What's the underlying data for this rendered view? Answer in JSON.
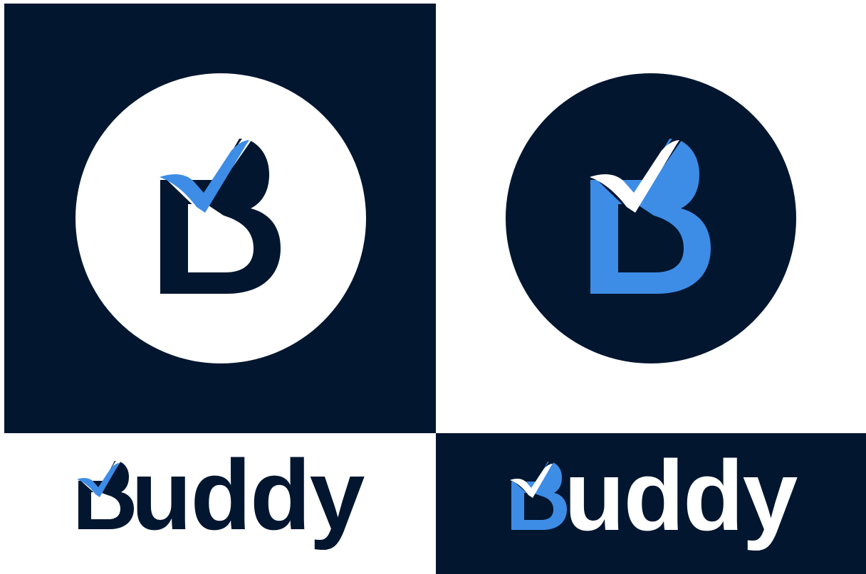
{
  "brand": {
    "wordmark_rest": "uddy",
    "wordmark_full": "Buddy",
    "letter": "B"
  },
  "colors": {
    "navy": "#02162f",
    "blue": "#3d8de6",
    "white": "#ffffff"
  },
  "icons": {
    "monogram": "b-checkmark-icon"
  }
}
